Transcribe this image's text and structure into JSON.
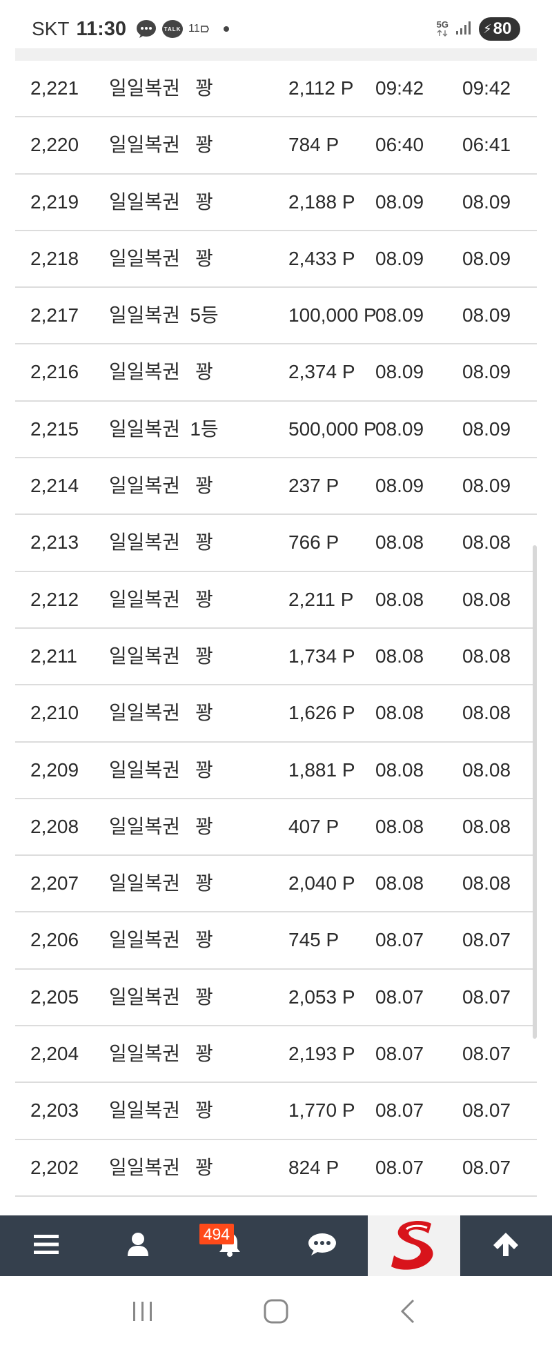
{
  "status_bar": {
    "carrier": "SKT",
    "time": "11:30",
    "talk_label": "TALK",
    "app_notification": "11",
    "network": "5G",
    "battery": "80"
  },
  "rows": [
    {
      "id": "2,221",
      "name": "일일복권",
      "result": "꽝",
      "points": "2,112 P",
      "date1": "09:42",
      "date2": "09:42"
    },
    {
      "id": "2,220",
      "name": "일일복권",
      "result": "꽝",
      "points": "784 P",
      "date1": "06:40",
      "date2": "06:41"
    },
    {
      "id": "2,219",
      "name": "일일복권",
      "result": "꽝",
      "points": "2,188 P",
      "date1": "08.09",
      "date2": "08.09"
    },
    {
      "id": "2,218",
      "name": "일일복권",
      "result": "꽝",
      "points": "2,433 P",
      "date1": "08.09",
      "date2": "08.09"
    },
    {
      "id": "2,217",
      "name": "일일복권",
      "result": "5등",
      "points": "100,000 P",
      "date1": "08.09",
      "date2": "08.09"
    },
    {
      "id": "2,216",
      "name": "일일복권",
      "result": "꽝",
      "points": "2,374 P",
      "date1": "08.09",
      "date2": "08.09"
    },
    {
      "id": "2,215",
      "name": "일일복권",
      "result": "1등",
      "points": "500,000 P",
      "date1": "08.09",
      "date2": "08.09"
    },
    {
      "id": "2,214",
      "name": "일일복권",
      "result": "꽝",
      "points": "237 P",
      "date1": "08.09",
      "date2": "08.09"
    },
    {
      "id": "2,213",
      "name": "일일복권",
      "result": "꽝",
      "points": "766 P",
      "date1": "08.08",
      "date2": "08.08"
    },
    {
      "id": "2,212",
      "name": "일일복권",
      "result": "꽝",
      "points": "2,211 P",
      "date1": "08.08",
      "date2": "08.08"
    },
    {
      "id": "2,211",
      "name": "일일복권",
      "result": "꽝",
      "points": "1,734 P",
      "date1": "08.08",
      "date2": "08.08"
    },
    {
      "id": "2,210",
      "name": "일일복권",
      "result": "꽝",
      "points": "1,626 P",
      "date1": "08.08",
      "date2": "08.08"
    },
    {
      "id": "2,209",
      "name": "일일복권",
      "result": "꽝",
      "points": "1,881 P",
      "date1": "08.08",
      "date2": "08.08"
    },
    {
      "id": "2,208",
      "name": "일일복권",
      "result": "꽝",
      "points": "407 P",
      "date1": "08.08",
      "date2": "08.08"
    },
    {
      "id": "2,207",
      "name": "일일복권",
      "result": "꽝",
      "points": "2,040 P",
      "date1": "08.08",
      "date2": "08.08"
    },
    {
      "id": "2,206",
      "name": "일일복권",
      "result": "꽝",
      "points": "745 P",
      "date1": "08.07",
      "date2": "08.07"
    },
    {
      "id": "2,205",
      "name": "일일복권",
      "result": "꽝",
      "points": "2,053 P",
      "date1": "08.07",
      "date2": "08.07"
    },
    {
      "id": "2,204",
      "name": "일일복권",
      "result": "꽝",
      "points": "2,193 P",
      "date1": "08.07",
      "date2": "08.07"
    },
    {
      "id": "2,203",
      "name": "일일복권",
      "result": "꽝",
      "points": "1,770 P",
      "date1": "08.07",
      "date2": "08.07"
    },
    {
      "id": "2,202",
      "name": "일일복권",
      "result": "꽝",
      "points": "824 P",
      "date1": "08.07",
      "date2": "08.07"
    }
  ],
  "bottom_bar": {
    "menu_icon": "hamburger-icon",
    "profile_icon": "user-icon",
    "notification_icon": "bell-icon",
    "notification_badge": "494",
    "chat_icon": "chat-icon",
    "logo_icon": "site-logo-icon",
    "top_icon": "arrow-up-icon",
    "background": "#35404d",
    "badge_color": "#ff4a1a",
    "logo_color": "#d8141b"
  },
  "system_nav": {
    "recents_icon": "recents-icon",
    "home_icon": "home-icon",
    "back_icon": "back-icon"
  }
}
